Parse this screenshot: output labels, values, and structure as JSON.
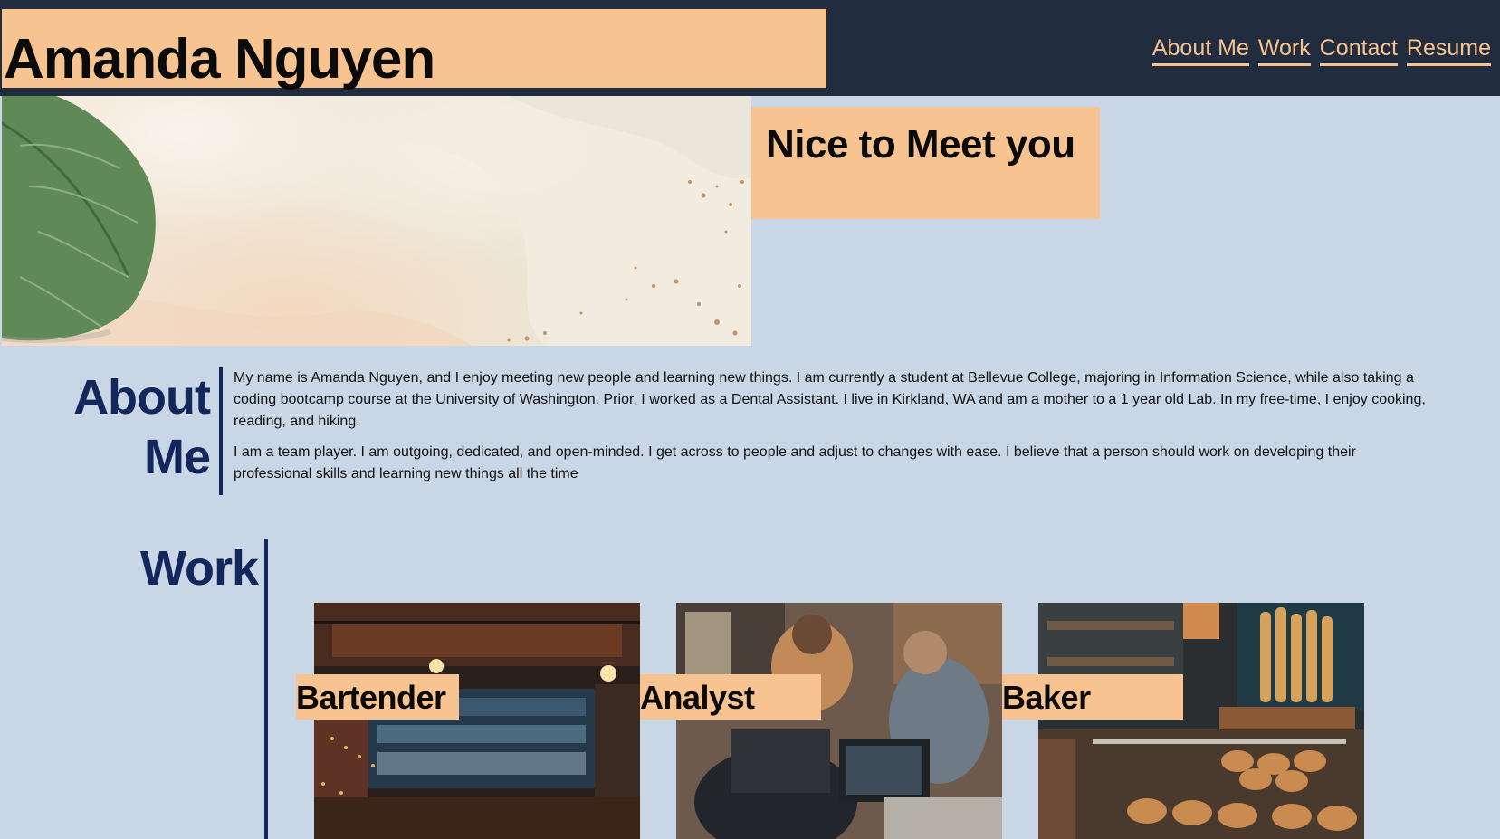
{
  "header": {
    "name": "Amanda Nguyen",
    "nav": [
      "About Me",
      "Work",
      "Contact",
      "Resume"
    ]
  },
  "hero": {
    "greeting": "Nice to Meet you",
    "image": "leaf-abstract-paint-image"
  },
  "about": {
    "title_line1": "About",
    "title_line2": "Me",
    "paragraphs": [
      "My name is Amanda Nguyen, and I enjoy meeting new people and learning new things. I am currently a student at Bellevue College, majoring in Information Science, while also taking a coding bootcamp course at the University of Washington. Prior, I worked as a Dental Assistant. I live in Kirkland, WA and am a mother to a 1 year old Lab. In my free-time, I enjoy cooking, reading, and hiking.",
      "I am a team player. I am outgoing, dedicated, and open-minded. I get across to people and adjust to changes with ease. I believe that a person should work on developing their professional skills and learning new things all the time"
    ]
  },
  "work": {
    "title": "Work",
    "cards": [
      {
        "label": "Bartender",
        "image": "bar-interior-image"
      },
      {
        "label": "Analyst",
        "image": "laptop-meeting-image"
      },
      {
        "label": "Baker",
        "image": "bakery-bread-image"
      }
    ]
  },
  "colors": {
    "navy": "#212c3e",
    "peach": "#f7c491",
    "background": "#c9d6e6",
    "heading": "#13275c"
  }
}
